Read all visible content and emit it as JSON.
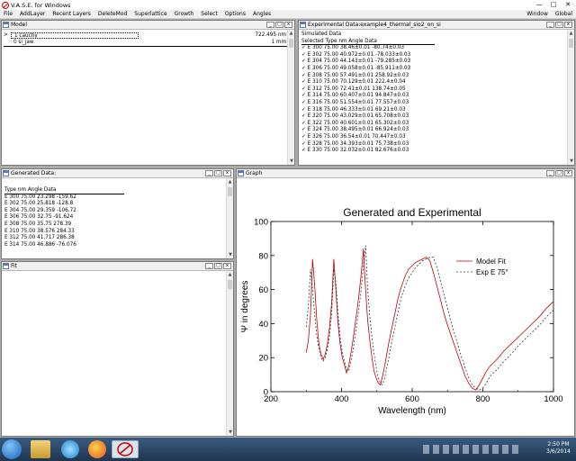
{
  "window": {
    "title": "V.A.S.E. for Windows",
    "right_menus": [
      "Window",
      "Global"
    ]
  },
  "menu": [
    "File",
    "AddLayer",
    "Recent Layers",
    "DeleteMod",
    "Superlattice",
    "Growth",
    "Select",
    "Options",
    "Angles"
  ],
  "model": {
    "title": "Model",
    "rows": [
      {
        "marker": ">",
        "name": "1 cauchy",
        "value": "722.495 nm"
      },
      {
        "marker": "",
        "name": "0 si_jaw",
        "value": "1 mm"
      }
    ]
  },
  "exp": {
    "title": "Experimental Data:example4_thermal_sio2_on_si",
    "sim": "Simulated Data",
    "header": "Selected Type  nm  Angle  Data",
    "rows": [
      "E  300  75.00  38.46±0.01  -80.74±0.03",
      "E  302  75.00  40.972±0.01  -78.033±0.03",
      "E  304  75.00  44.143±0.01  -79.285±0.03",
      "E  306  75.00  49.058±0.01  -85.911±0.03",
      "E  308  75.00  57.491±0.01  258.92±0.03",
      "E  310  75.00  70.129±0.01  222.4±0.04",
      "E  312  75.00  72.41±0.01  138.74±0.05",
      "E  314  75.00  60.407±0.01  94.847±0.03",
      "E  316  75.00  51.554±0.01  77.557±0.03",
      "E  318  75.00  46.333±0.01  69.21±0.03",
      "E  320  75.00  43.029±0.01  65.708±0.03",
      "E  322  75.00  40.601±0.01  65.302±0.03",
      "E  324  75.00  38.495±0.01  66.924±0.03",
      "E  326  75.00  36.54±0.01  70.447±0.03",
      "E  328  75.00  34.393±0.01  75.738±0.03",
      "E  330  75.00  32.032±0.01  82.676±0.03"
    ]
  },
  "gen": {
    "title": "Generated Data:",
    "header": "Type  nm  Angle  Data",
    "rows": [
      "E  300  75.00  23.298  -159.62",
      "E  302  75.00  25.818  -128.8",
      "E  304  75.00  29.359  -106.72",
      "E  306  75.00  32.75  -91.624",
      "E  308  75.00  35.75  278.39",
      "E  310  75.00  38.576  284.33",
      "E  312  75.00  41.717  286.38",
      "E  314  75.00  46.886  -76.076"
    ]
  },
  "fit": {
    "title": "Fit"
  },
  "graph": {
    "title": "Graph"
  },
  "chart_data": {
    "type": "line",
    "title": "Generated and Experimental",
    "xlabel": "Wavelength (nm)",
    "ylabel": "Ψ in degrees",
    "xlim": [
      200,
      1000
    ],
    "ylim": [
      0,
      100
    ],
    "xticks": [
      200,
      400,
      600,
      800,
      1000
    ],
    "yticks": [
      0,
      20,
      40,
      60,
      80,
      100
    ],
    "legend_position": "top-right",
    "series": [
      {
        "name": "Model Fit",
        "color": "#c00000",
        "dash": "",
        "x": [
          300,
          306,
          312,
          318,
          324,
          330,
          336,
          342,
          348,
          354,
          360,
          366,
          372,
          378,
          384,
          390,
          396,
          402,
          408,
          414,
          420,
          426,
          432,
          438,
          444,
          450,
          456,
          462,
          468,
          474,
          480,
          486,
          492,
          498,
          504,
          510,
          516,
          522,
          528,
          534,
          540,
          546,
          552,
          558,
          564,
          570,
          580,
          590,
          600,
          610,
          620,
          630,
          640,
          650,
          660,
          670,
          680,
          690,
          700,
          710,
          720,
          730,
          740,
          750,
          760,
          770,
          780,
          790,
          800,
          810,
          820,
          840,
          860,
          880,
          900,
          920,
          940,
          960,
          980,
          1000
        ],
        "y": [
          23,
          30,
          45,
          78,
          62,
          42,
          28,
          22,
          19,
          22,
          28,
          38,
          52,
          78,
          60,
          40,
          28,
          20,
          16,
          11,
          15,
          22,
          30,
          39,
          48,
          58,
          70,
          84,
          60,
          42,
          30,
          20,
          12,
          8,
          5,
          4,
          9,
          15,
          22,
          29,
          35,
          41,
          47,
          53,
          58,
          62,
          68,
          72,
          74,
          76,
          77,
          78,
          79,
          77,
          70,
          62,
          54,
          46,
          39,
          33,
          27,
          21,
          15,
          9,
          5,
          2,
          1,
          4,
          8,
          12,
          15,
          19,
          24,
          28,
          32,
          36,
          40,
          44,
          49,
          53
        ]
      },
      {
        "name": "Exp E 75°",
        "color": "#333333",
        "dash": "2,2",
        "x": [
          300,
          306,
          312,
          318,
          324,
          330,
          336,
          342,
          348,
          354,
          360,
          366,
          372,
          378,
          384,
          390,
          396,
          402,
          408,
          414,
          420,
          426,
          432,
          438,
          444,
          450,
          456,
          462,
          468,
          474,
          480,
          486,
          492,
          498,
          504,
          510,
          516,
          522,
          528,
          534,
          540,
          546,
          552,
          558,
          564,
          570,
          580,
          590,
          600,
          610,
          620,
          630,
          640,
          650,
          660,
          670,
          680,
          690,
          700,
          710,
          720,
          730,
          740,
          750,
          760,
          770,
          780,
          790,
          800,
          810,
          820,
          840,
          860,
          880,
          900,
          920,
          940,
          960,
          980,
          1000
        ],
        "y": [
          38,
          50,
          72,
          60,
          45,
          33,
          25,
          20,
          18,
          20,
          25,
          33,
          46,
          72,
          64,
          45,
          32,
          23,
          18,
          13,
          12,
          17,
          24,
          32,
          41,
          50,
          61,
          74,
          86,
          60,
          44,
          32,
          22,
          14,
          8,
          5,
          4,
          8,
          14,
          20,
          27,
          33,
          39,
          45,
          51,
          56,
          62,
          67,
          70,
          73,
          75,
          77,
          78,
          79,
          79,
          73,
          65,
          57,
          49,
          41,
          34,
          27,
          20,
          14,
          8,
          4,
          2,
          1,
          2,
          5,
          9,
          13,
          18,
          22,
          27,
          31,
          35,
          39,
          44,
          48
        ]
      }
    ]
  }
}
